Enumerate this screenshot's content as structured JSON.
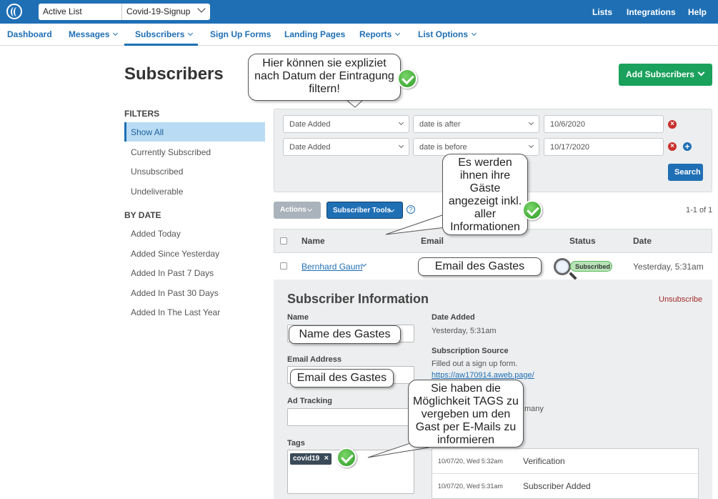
{
  "topbar": {
    "list_label": "Active List",
    "list_value": "Covid-19-Signup",
    "links": [
      "Lists",
      "Integrations",
      "Help"
    ]
  },
  "nav": [
    "Dashboard",
    "Messages",
    "Subscribers",
    "Sign Up Forms",
    "Landing Pages",
    "Reports",
    "List Options"
  ],
  "page": {
    "title": "Subscribers",
    "add_button": "Add Subscribers"
  },
  "sidebar": {
    "filters_heading": "FILTERS",
    "filters": [
      "Show All",
      "Currently Subscribed",
      "Unsubscribed",
      "Undeliverable"
    ],
    "bydate_heading": "BY DATE",
    "bydate": [
      "Added Today",
      "Added Since Yesterday",
      "Added In Past 7 Days",
      "Added In Past 30 Days",
      "Added In The Last Year"
    ]
  },
  "filter": {
    "rows": [
      {
        "field": "Date Added",
        "op": "date is after",
        "value": "10/6/2020"
      },
      {
        "field": "Date Added",
        "op": "date is before",
        "value": "10/17/2020"
      }
    ],
    "search": "Search"
  },
  "toolbar": {
    "actions": "Actions",
    "tools": "Subscriber Tools",
    "help": "?",
    "pagecount": "1-1 of 1"
  },
  "table": {
    "headers": [
      "Name",
      "Email",
      "Status",
      "Date"
    ],
    "row": {
      "name": "Bernhard Gaum",
      "status": "Subscribed",
      "date": "Yesterday, 5:31am"
    }
  },
  "detail": {
    "title": "Subscriber Information",
    "unsubscribe": "Unsubscribe",
    "name_label": "Name",
    "email_label": "Email Address",
    "adtracking_label": "Ad Tracking",
    "tags_label": "Tags",
    "tag": "covid19",
    "tag_remove": "×",
    "date_added_label": "Date Added",
    "date_added_value": "Yesterday, 5:31am",
    "source_label": "Subscription Source",
    "source_text": "Filled out a sign up form.",
    "source_link": "https://aw170914.aweb.page/",
    "partial_text": "many",
    "history": [
      {
        "date": "10/07/20, Wed 5:32am",
        "event": "Verification"
      },
      {
        "date": "10/07/20, Wed 5:31am",
        "event": "Subscriber Added"
      }
    ]
  },
  "annotations": {
    "callout1": [
      "Hier können sie expliziet",
      "nach Datum der Eintragung",
      "filtern!"
    ],
    "callout2": [
      "Es werden",
      "ihnen ihre",
      "Gäste",
      "angezeigt inkl.",
      "aller",
      "Informationen"
    ],
    "callout3": [
      "Sie haben die",
      "Möglichkeit TAGS zu",
      "vergeben um den",
      "Gast per E-Mails zu",
      "informieren"
    ],
    "email_overlay": "Email des Gastes",
    "name_overlay": "Name des Gastes",
    "email_overlay2": "Email des Gastes"
  }
}
